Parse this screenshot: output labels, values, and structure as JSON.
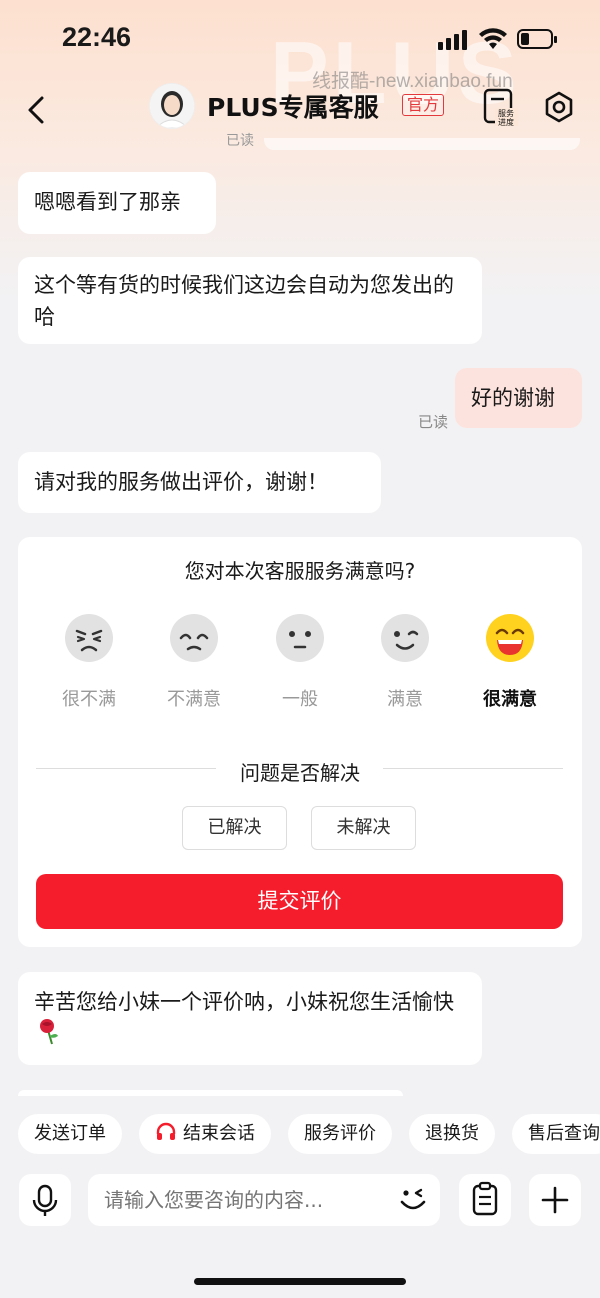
{
  "status_bar": {
    "time": "22:46",
    "battery_level": 0.3
  },
  "watermark": "线报酷-new.xianbao.fun",
  "header": {
    "title": "PLUS专属客服",
    "badge": "官方",
    "progress_icon_label": "服务进度",
    "back_icon": "chevron-left-icon",
    "settings_icon": "settings-icon"
  },
  "background_text": "PLUS",
  "peek_read": "已读",
  "messages": [
    {
      "from": "agent",
      "text": "嗯嗯看到了那亲"
    },
    {
      "from": "agent",
      "text": "这个等有货的时候我们这边会自动为您发出的哈"
    },
    {
      "from": "user",
      "text": "好的谢谢",
      "status": "已读"
    },
    {
      "from": "agent",
      "text": "请对我的服务做出评价，谢谢！"
    },
    {
      "from": "agent",
      "text": "辛苦您给小妹一个评价呐，小妹祝您生活愉快"
    }
  ],
  "rating_card": {
    "question": "您对本次客服服务满意吗?",
    "options": [
      "很不满",
      "不满意",
      "一般",
      "满意",
      "很满意"
    ],
    "selected": 4,
    "resolve_title": "问题是否解决",
    "resolve_options": [
      "已解决",
      "未解决"
    ],
    "submit_label": "提交评价"
  },
  "quick_actions": [
    "发送订单",
    "结束会话",
    "服务评价",
    "退换货",
    "售后查询"
  ],
  "input": {
    "placeholder": "请输入您要咨询的内容..."
  },
  "colors": {
    "accent": "#f51d2c",
    "user_bubble": "#fde3dd",
    "official": "#e4393c"
  }
}
